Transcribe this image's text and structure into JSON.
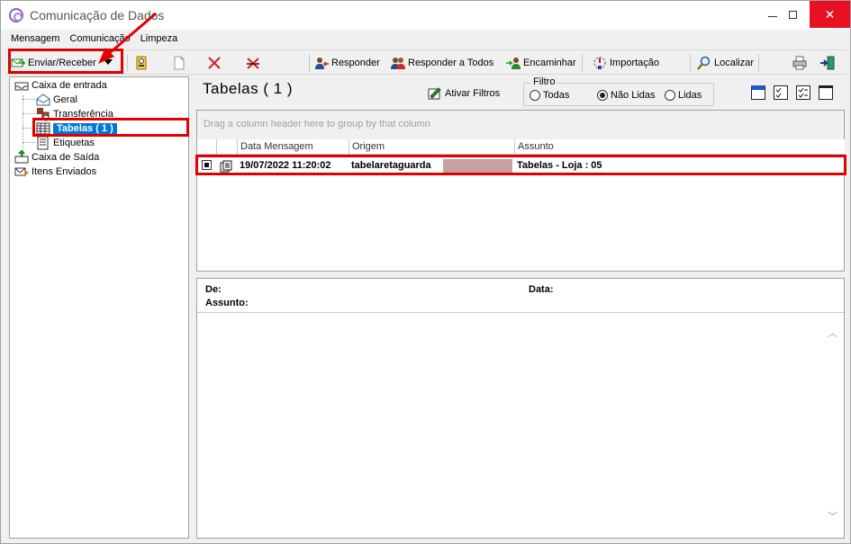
{
  "window": {
    "title": "Comunicação de Dados"
  },
  "menu": [
    "Mensagem",
    "Comunicação",
    "Limpeza"
  ],
  "toolbar": {
    "send_receive": "Enviar/Receber",
    "reply": "Responder",
    "reply_all": "Responder a Todos",
    "forward": "Encaminhar",
    "import": "Importação",
    "find": "Localizar"
  },
  "tree": {
    "inbox": "Caixa de entrada",
    "general": "Geral",
    "transfer": "Transferência",
    "tables": "Tabelas  ( 1 )",
    "labels": "Etiquetas",
    "outbox": "Caixa de Saída",
    "sent": "Itens Enviados"
  },
  "pane": {
    "title": "Tabelas  ( 1 )",
    "activate_filters": "Ativar Filtros",
    "filter": {
      "legend": "Filtro",
      "options": [
        "Todas",
        "Não Lidas",
        "Lidas"
      ],
      "selected": "Não Lidas"
    }
  },
  "grid": {
    "group_hint": "Drag a column header here to group by that column",
    "columns": [
      "Data Mensagem",
      "Origem",
      "Assunto"
    ],
    "rows": [
      {
        "date": "19/07/2022 11:20:02",
        "origin": "tabelaretaguarda",
        "subject": "Tabelas - Loja : 05"
      }
    ]
  },
  "preview": {
    "from_label": "De:",
    "date_label": "Data:",
    "subject_label": "Assunto:"
  },
  "colors": {
    "highlight": "#e00000",
    "selection": "#0078d7",
    "close_button": "#e81123"
  }
}
